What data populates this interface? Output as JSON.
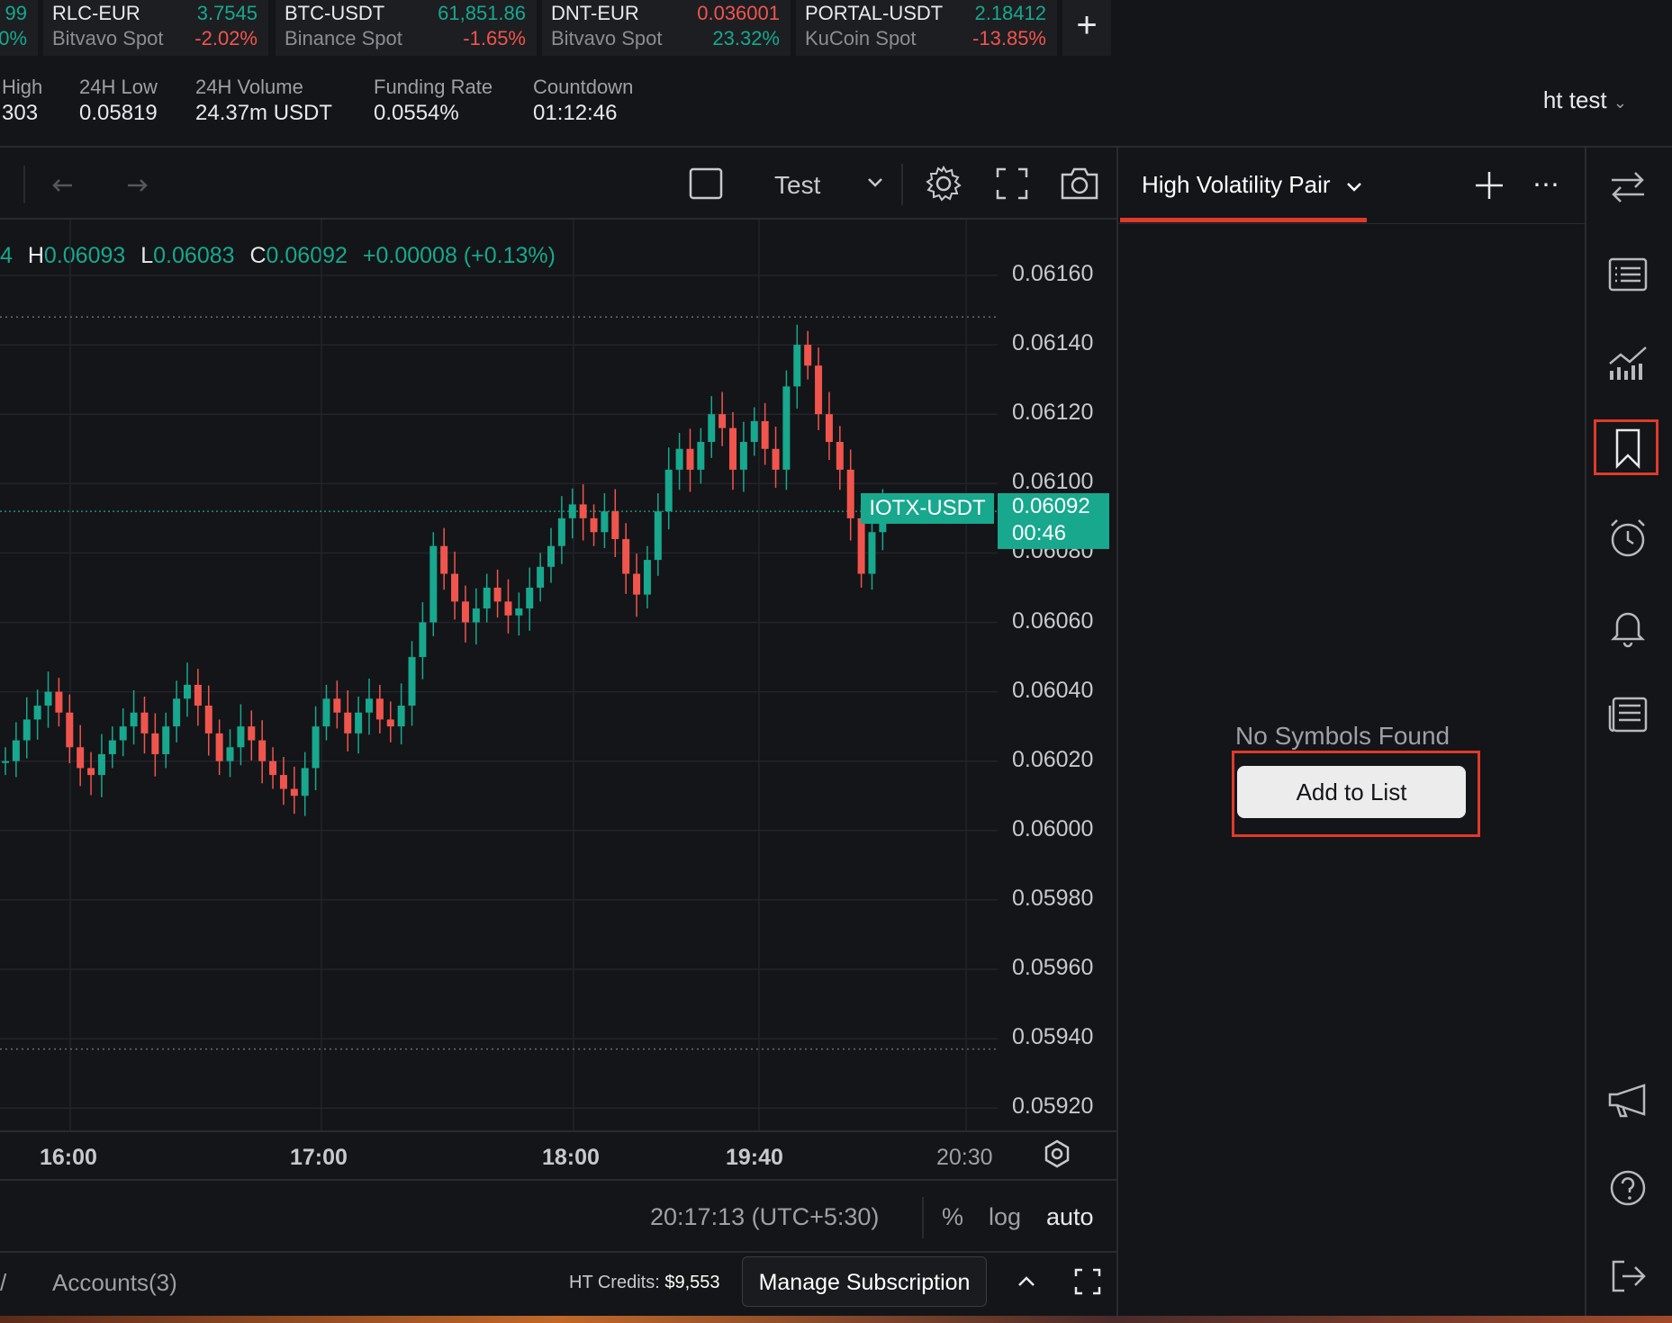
{
  "ticker": [
    {
      "symbol": "",
      "exchange": "",
      "price": "99",
      "change": "0%",
      "price_dir": "up",
      "change_dir": "up"
    },
    {
      "symbol": "RLC-EUR",
      "exchange": "Bitvavo Spot",
      "price": "3.7545",
      "change": "-2.02%",
      "price_dir": "up",
      "change_dir": "dn"
    },
    {
      "symbol": "BTC-USDT",
      "exchange": "Binance Spot",
      "price": "61,851.86",
      "change": "-1.65%",
      "price_dir": "up",
      "change_dir": "dn"
    },
    {
      "symbol": "DNT-EUR",
      "exchange": "Bitvavo Spot",
      "price": "0.036001",
      "change": "23.32%",
      "price_dir": "dn",
      "change_dir": "up"
    },
    {
      "symbol": "PORTAL-USDT",
      "exchange": "KuCoin Spot",
      "price": "2.18412",
      "change": "-13.85%",
      "price_dir": "up",
      "change_dir": "dn"
    }
  ],
  "ticker_add": "+",
  "stats": [
    {
      "label": "High",
      "value": "303"
    },
    {
      "label": "24H Low",
      "value": "0.05819"
    },
    {
      "label": "24H Volume",
      "value": "24.37m USDT"
    },
    {
      "label": "Funding Rate",
      "value": "0.0554%"
    },
    {
      "label": "Countdown",
      "value": "01:12:46"
    }
  ],
  "user": {
    "name": "ht test"
  },
  "toolbar": {
    "layout_name": "Test"
  },
  "ohlc": {
    "o_tail": "4",
    "h_label": "H",
    "h": "0.06093",
    "l_label": "L",
    "l": "0.06083",
    "c_label": "C",
    "c": "0.06092",
    "change": "+0.00008 (+0.13%)"
  },
  "price_tag": {
    "symbol": "IOTX-USDT",
    "price": "0.06092",
    "timer": "00:46"
  },
  "chart_data": {
    "type": "candlestick",
    "y_ticks": [
      "0.06160",
      "0.06140",
      "0.06120",
      "0.06100",
      "0.06080",
      "0.06060",
      "0.06040",
      "0.06020",
      "0.06000",
      "0.05980",
      "0.05960",
      "0.05940",
      "0.05920"
    ],
    "x_ticks": [
      "16:00",
      "17:00",
      "18:00",
      "19:40",
      "20:30"
    ],
    "ylim": [
      0.0591,
      0.0617
    ],
    "grid": true,
    "last_price": 0.06092,
    "high_line": 0.06148,
    "low_line": 0.05937
  },
  "bottom": {
    "time": "20:17:13 (UTC+5:30)",
    "pct": "%",
    "log": "log",
    "auto": "auto",
    "accounts": "Accounts(3)",
    "credits_label": "HT Credits:",
    "credits_value": "$9,553",
    "manage": "Manage Subscription"
  },
  "panel": {
    "title": "High Volatility Pair",
    "empty": "No Symbols Found",
    "add_button": "Add to List"
  },
  "colors": {
    "up": "#17a88e",
    "down": "#f0554d",
    "highlight": "#e03a2a"
  }
}
